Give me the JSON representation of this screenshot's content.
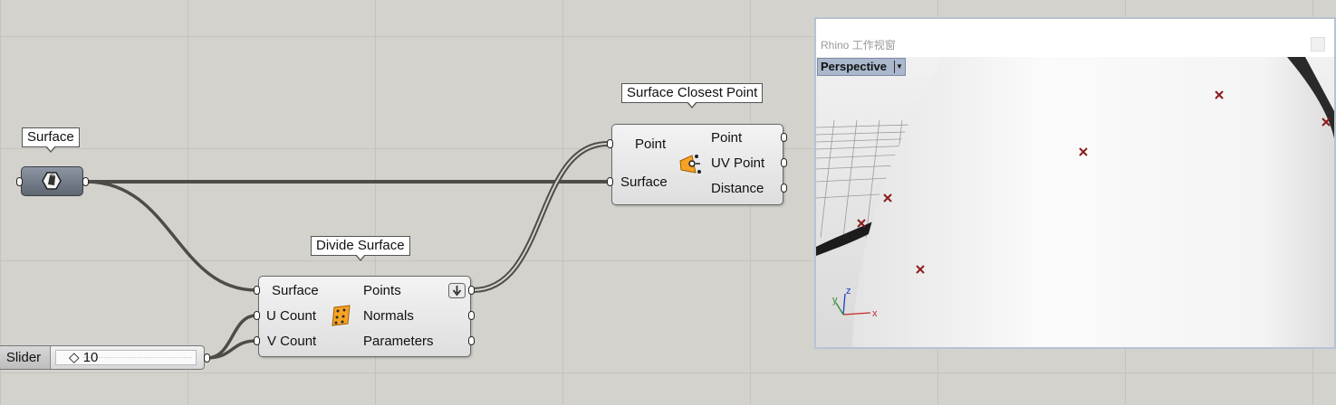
{
  "canvas": {
    "background_color": "#d4d2cc",
    "wire_color": "#4f4c47"
  },
  "surface_param": {
    "tag": "Surface",
    "icon": "surface-param-icon"
  },
  "divide_surface": {
    "tag": "Divide Surface",
    "inputs": [
      "Surface",
      "U Count",
      "V Count"
    ],
    "outputs": [
      "Points",
      "Normals",
      "Parameters"
    ],
    "icon": "divide-surface-icon",
    "flatten_icon": "arrow-down-icon"
  },
  "surface_closest_point": {
    "tag": "Surface Closest Point",
    "inputs": [
      "Point",
      "Surface"
    ],
    "outputs": [
      "Point",
      "UV Point",
      "Distance"
    ],
    "icon": "surface-closest-point-icon"
  },
  "slider": {
    "label": "Slider",
    "value_display": "◇ 10",
    "value": 10
  },
  "viewport": {
    "window_title": "Rhino 工作视窗",
    "view_name": "Perspective",
    "axis_labels": {
      "x": "x",
      "y": "y",
      "z": "z"
    }
  }
}
